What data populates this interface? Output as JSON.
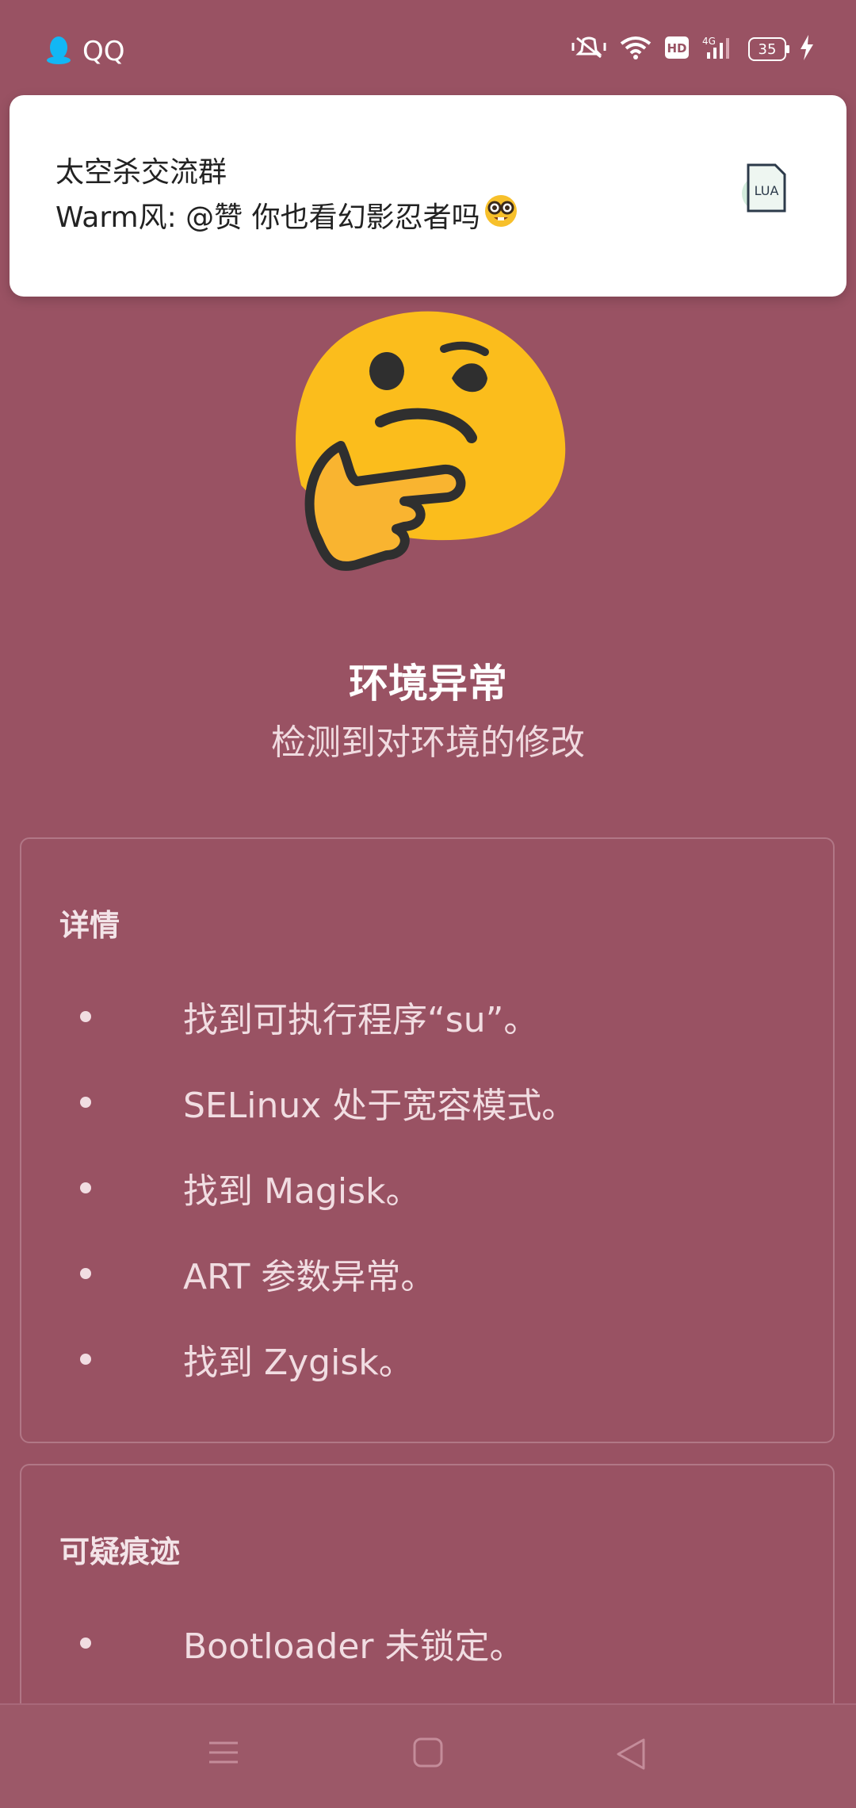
{
  "status_bar": {
    "app_name": "QQ",
    "battery": "35",
    "network": "4G"
  },
  "notification": {
    "title": "太空杀交流群",
    "message": "Warm风: @赞 你也看幻影忍者吗",
    "file_label": "LUA"
  },
  "main": {
    "title": "环境异常",
    "subtitle": "检测到对环境的修改"
  },
  "details": {
    "heading": "详情",
    "items": [
      "找到可执行程序“su”。",
      "SELinux 处于宽容模式。",
      "找到 Magisk。",
      "ART 参数异常。",
      "找到 Zygisk。"
    ]
  },
  "suspicious": {
    "heading": "可疑痕迹",
    "items": [
      "Bootloader 未锁定。"
    ]
  },
  "colors": {
    "background": "#995263",
    "card_border": "#b17786"
  }
}
